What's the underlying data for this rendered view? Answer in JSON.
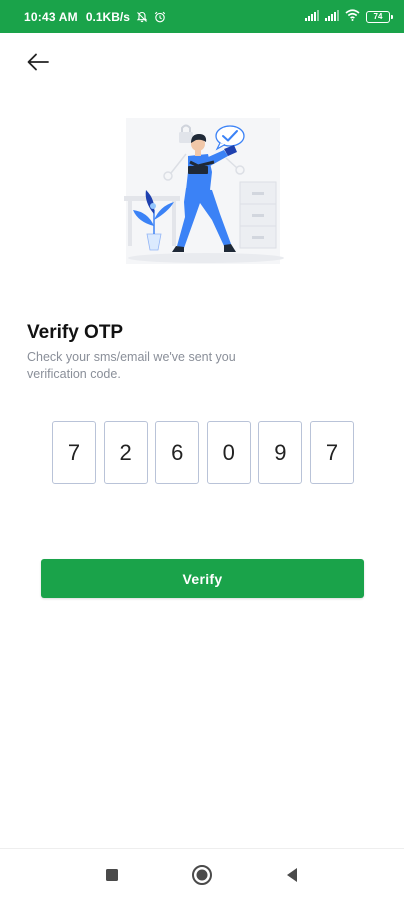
{
  "status_bar": {
    "time": "10:43 AM",
    "network_speed": "0.1KB/s",
    "battery_level": "74",
    "icons": [
      "notification-muted-icon",
      "alarm-icon",
      "signal-icon",
      "signal-icon",
      "wifi-icon",
      "battery-icon"
    ]
  },
  "header": {
    "back_icon": "arrow-left-icon"
  },
  "main": {
    "title": "Verify OTP",
    "subtitle": "Check your sms/email we've sent you verification code.",
    "otp_digits": [
      "7",
      "2",
      "6",
      "0",
      "9",
      "7"
    ],
    "verify_label": "Verify"
  },
  "nav_bar": {
    "icons": [
      "recent-apps-icon",
      "home-icon",
      "back-icon"
    ]
  },
  "colors": {
    "brand_green": "#1aa34a",
    "otp_border": "#b9c3d8",
    "subtitle_text": "#8a8f99",
    "illustration_blue": "#3b82f6"
  }
}
